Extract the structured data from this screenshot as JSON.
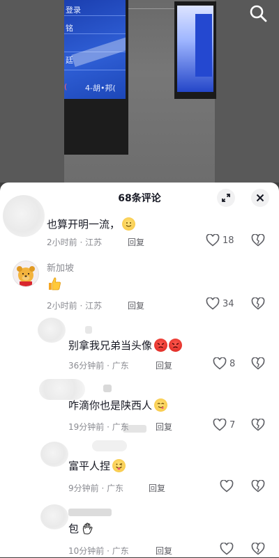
{
  "sheet": {
    "title": "68条评论"
  },
  "comments": [
    {
      "username": "",
      "text": "也算开明一流，",
      "time": "2小时前",
      "location": "江苏",
      "reply": "回复",
      "likes": "18"
    },
    {
      "username": "新加坡",
      "text": "",
      "time": "2小时前",
      "location": "江苏",
      "reply": "回复",
      "likes": "34"
    },
    {
      "username": "",
      "text": "别拿我兄弟当头像",
      "time": "36分钟前",
      "location": "广东",
      "reply": "回复",
      "likes": "8"
    },
    {
      "username": "",
      "text": "咋滴你也是陕西人",
      "time": "19分钟前",
      "location": "广东",
      "reply": "回复",
      "likes": "7"
    },
    {
      "username": "",
      "text": "富平人捏",
      "time": "9分钟前",
      "location": "广东",
      "reply": "回复",
      "likes": ""
    },
    {
      "username": "",
      "text": "包",
      "time": "10分钟前",
      "location": "广东",
      "reply": "回复",
      "likes": ""
    }
  ],
  "separator": "·",
  "video_screen_text": {
    "top": "登录",
    "row1": "铭",
    "row2": "廷",
    "row3_left": "(",
    "row3_right": "4-胡•邦("
  },
  "icons": {
    "search": "search-icon",
    "expand": "expand-icon",
    "close": "close-icon",
    "like": "heart-outline-icon",
    "dislike": "broken-heart-icon"
  },
  "colors": {
    "text_primary": "#161823",
    "text_secondary": "#8a8b91",
    "sheet_bg": "#ffffff"
  }
}
